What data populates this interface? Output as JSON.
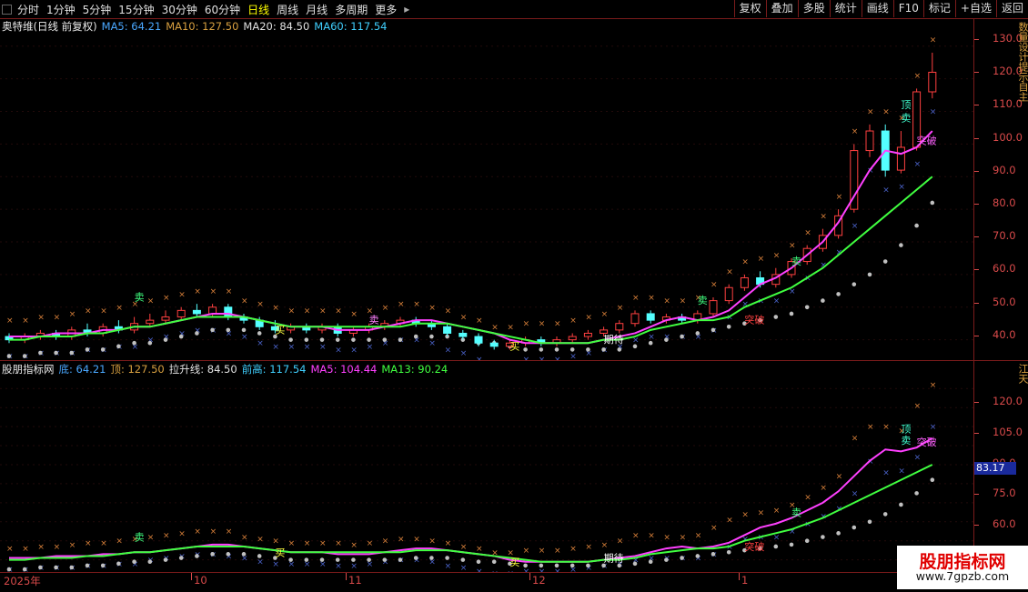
{
  "toolbar": {
    "left_items": [
      "分时",
      "1分钟",
      "5分钟",
      "15分钟",
      "30分钟",
      "60分钟",
      "日线",
      "周线",
      "月线",
      "多周期",
      "更多"
    ],
    "active_item": "日线",
    "right_items": [
      "复权",
      "叠加",
      "多股",
      "统计",
      "画线",
      "F10",
      "标记",
      "+自选",
      "返回"
    ]
  },
  "main_pane": {
    "title": "奥特维(日线 前复权)",
    "legend": [
      {
        "label": "MA5: 64.21",
        "color": "#4aa8ff"
      },
      {
        "label": "MA10: 127.50",
        "color": "#d8a040"
      },
      {
        "label": "MA20: 84.50",
        "color": "#e0e0e0"
      },
      {
        "label": "MA60: 117.54",
        "color": "#40d0ff"
      }
    ],
    "y_ticks": [
      "130.0",
      "120.0",
      "110.0",
      "100.0",
      "90.0",
      "80.0",
      "70.0",
      "60.0",
      "50.0",
      "40.0"
    ],
    "annotations": [
      "顶",
      "卖",
      "卖",
      "买",
      "卖",
      "买",
      "期待",
      "突破",
      "突破",
      "卖",
      "卖"
    ]
  },
  "indicator_pane": {
    "title": "股朋指标网",
    "legend": [
      {
        "label": "底: 64.21",
        "color": "#4aa8ff"
      },
      {
        "label": "顶: 127.50",
        "color": "#d8a040"
      },
      {
        "label": "拉升线: 84.50",
        "color": "#e0e0e0"
      },
      {
        "label": "前高: 117.54",
        "color": "#40d0ff"
      },
      {
        "label": "MA5: 104.44",
        "color": "#ff40ff"
      },
      {
        "label": "MA13: 90.24",
        "color": "#40ff40"
      }
    ],
    "y_ticks": [
      "120.0",
      "105.0",
      "90.0",
      "75.0",
      "60.0"
    ],
    "current_value": "83.17",
    "annotations": [
      "顶",
      "卖",
      "卖",
      "卖",
      "期待",
      "突破",
      "突破",
      "买",
      "买"
    ]
  },
  "date_axis": {
    "labels": [
      "2025年",
      "10",
      "11",
      "12",
      "1"
    ]
  },
  "side_glyphs": [
    "数",
    "量",
    "设",
    "计",
    "提",
    "示",
    "自",
    "主",
    "江",
    "天"
  ],
  "watermark": {
    "title": "股朋指标网",
    "url": "www.7gpzb.com"
  },
  "chart_data": {
    "type": "candlestick",
    "series": [
      {
        "name": "MA5",
        "values": [
          41,
          41,
          41,
          42,
          42,
          42,
          43,
          43,
          44,
          44,
          45,
          46,
          47,
          48,
          48,
          47,
          46,
          45,
          44,
          44,
          44,
          43,
          43,
          43,
          44,
          45,
          46,
          46,
          45,
          44,
          43,
          42,
          40,
          39,
          39,
          39,
          39,
          39,
          40,
          41,
          42,
          44,
          46,
          47,
          46,
          47,
          49,
          53,
          57,
          59,
          62,
          66,
          70,
          76,
          84,
          92,
          98,
          97,
          99,
          104
        ]
      },
      {
        "name": "MA13",
        "values": [
          40,
          40,
          41,
          41,
          41,
          42,
          42,
          43,
          44,
          44,
          45,
          46,
          47,
          47,
          47,
          47,
          46,
          45,
          44,
          44,
          44,
          44,
          44,
          44,
          44,
          44,
          45,
          45,
          45,
          44,
          43,
          42,
          41,
          40,
          39,
          39,
          39,
          39,
          40,
          40,
          41,
          43,
          44,
          45,
          46,
          46,
          47,
          50,
          52,
          54,
          56,
          59,
          62,
          66,
          70,
          74,
          78,
          82,
          86,
          90
        ]
      },
      {
        "name": "拉升线",
        "values": [
          37,
          37,
          38,
          38,
          38,
          39,
          39,
          40,
          41,
          41,
          42,
          43,
          44,
          45,
          45,
          45,
          44,
          43,
          42,
          42,
          42,
          42,
          42,
          42,
          42,
          42,
          43,
          43,
          43,
          42,
          41,
          41,
          40,
          39,
          39,
          39,
          39,
          39,
          39,
          39,
          40,
          41,
          42,
          43,
          44,
          45,
          46,
          47,
          48,
          49,
          50,
          52,
          54,
          56,
          59,
          62,
          66,
          71,
          77,
          84
        ]
      }
    ],
    "candles": [
      [
        41,
        40,
        42,
        39
      ],
      [
        40,
        41,
        42,
        39
      ],
      [
        41,
        42,
        43,
        40
      ],
      [
        42,
        41,
        43,
        40
      ],
      [
        41,
        43,
        44,
        40
      ],
      [
        43,
        42,
        45,
        41
      ],
      [
        42,
        44,
        45,
        41
      ],
      [
        44,
        43,
        46,
        42
      ],
      [
        43,
        45,
        47,
        42
      ],
      [
        45,
        46,
        48,
        44
      ],
      [
        46,
        47,
        49,
        45
      ],
      [
        47,
        49,
        50,
        46
      ],
      [
        49,
        48,
        51,
        47
      ],
      [
        48,
        50,
        51,
        47
      ],
      [
        50,
        47,
        51,
        46
      ],
      [
        47,
        46,
        48,
        45
      ],
      [
        46,
        44,
        47,
        43
      ],
      [
        44,
        43,
        46,
        42
      ],
      [
        43,
        44,
        45,
        42
      ],
      [
        44,
        43,
        45,
        42
      ],
      [
        43,
        44,
        45,
        42
      ],
      [
        44,
        42,
        45,
        41
      ],
      [
        42,
        43,
        44,
        41
      ],
      [
        43,
        44,
        45,
        42
      ],
      [
        44,
        45,
        46,
        43
      ],
      [
        45,
        46,
        47,
        44
      ],
      [
        46,
        45,
        47,
        44
      ],
      [
        45,
        44,
        46,
        43
      ],
      [
        44,
        42,
        45,
        41
      ],
      [
        42,
        41,
        43,
        40
      ],
      [
        41,
        39,
        42,
        38
      ],
      [
        39,
        38,
        40,
        37
      ],
      [
        38,
        39,
        40,
        37
      ],
      [
        39,
        40,
        41,
        38
      ],
      [
        40,
        39,
        41,
        38
      ],
      [
        39,
        40,
        41,
        38
      ],
      [
        40,
        41,
        42,
        39
      ],
      [
        41,
        42,
        43,
        40
      ],
      [
        42,
        43,
        44,
        41
      ],
      [
        43,
        45,
        46,
        42
      ],
      [
        45,
        48,
        49,
        44
      ],
      [
        48,
        46,
        49,
        45
      ],
      [
        46,
        47,
        48,
        45
      ],
      [
        47,
        46,
        48,
        45
      ],
      [
        46,
        48,
        49,
        45
      ],
      [
        48,
        52,
        53,
        47
      ],
      [
        52,
        56,
        57,
        51
      ],
      [
        56,
        59,
        60,
        55
      ],
      [
        59,
        57,
        61,
        56
      ],
      [
        57,
        60,
        62,
        56
      ],
      [
        60,
        64,
        65,
        59
      ],
      [
        64,
        68,
        69,
        63
      ],
      [
        68,
        72,
        74,
        67
      ],
      [
        72,
        78,
        80,
        71
      ],
      [
        80,
        98,
        100,
        79
      ],
      [
        98,
        104,
        106,
        96
      ],
      [
        104,
        92,
        106,
        90
      ],
      [
        92,
        99,
        104,
        91
      ],
      [
        99,
        116,
        117,
        98
      ],
      [
        116,
        122,
        128,
        114
      ]
    ],
    "ylim": [
      36,
      133
    ],
    "xlabel": "",
    "ylabel": "",
    "x_labels": [
      "2025年",
      "10",
      "11",
      "12",
      "1"
    ]
  }
}
